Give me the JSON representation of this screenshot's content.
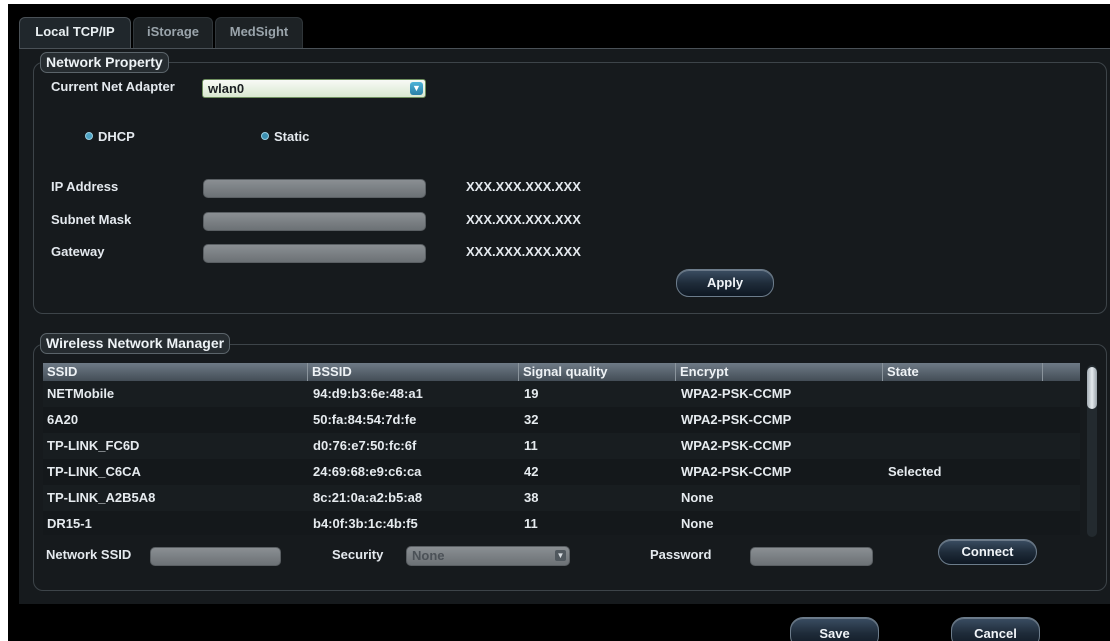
{
  "tabs": [
    {
      "label": "Local TCP/IP",
      "active": true
    },
    {
      "label": "iStorage",
      "active": false
    },
    {
      "label": "MedSight",
      "active": false
    }
  ],
  "network_property": {
    "title": "Network Property",
    "adapter_label": "Current Net Adapter",
    "adapter_value": "wlan0",
    "dhcp_label": "DHCP",
    "static_label": "Static",
    "ip_label": "IP Address",
    "ip_value": "XXX.XXX.XXX.XXX",
    "subnet_label": "Subnet Mask",
    "subnet_value": "XXX.XXX.XXX.XXX",
    "gateway_label": "Gateway",
    "gateway_value": "XXX.XXX.XXX.XXX",
    "apply_label": "Apply"
  },
  "wireless": {
    "title": "Wireless Network Manager",
    "columns": [
      "SSID",
      "BSSID",
      "Signal quality",
      "Encrypt",
      "State"
    ],
    "rows": [
      {
        "ssid": "NETMobile",
        "bssid": "94:d9:b3:6e:48:a1",
        "signal": "19",
        "encrypt": "WPA2-PSK-CCMP",
        "state": ""
      },
      {
        "ssid": "6A20",
        "bssid": "50:fa:84:54:7d:fe",
        "signal": "32",
        "encrypt": "WPA2-PSK-CCMP",
        "state": ""
      },
      {
        "ssid": "TP-LINK_FC6D",
        "bssid": "d0:76:e7:50:fc:6f",
        "signal": "11",
        "encrypt": "WPA2-PSK-CCMP",
        "state": ""
      },
      {
        "ssid": "TP-LINK_C6CA",
        "bssid": "24:69:68:e9:c6:ca",
        "signal": "42",
        "encrypt": "WPA2-PSK-CCMP",
        "state": "Selected"
      },
      {
        "ssid": "TP-LINK_A2B5A8",
        "bssid": "8c:21:0a:a2:b5:a8",
        "signal": "38",
        "encrypt": "None",
        "state": ""
      },
      {
        "ssid": "DR15-1",
        "bssid": "b4:0f:3b:1c:4b:f5",
        "signal": "11",
        "encrypt": "None",
        "state": ""
      }
    ],
    "network_ssid_label": "Network SSID",
    "security_label": "Security",
    "security_value": "None",
    "password_label": "Password",
    "connect_label": "Connect"
  },
  "footer": {
    "save_label": "Save",
    "cancel_label": "Cancel"
  },
  "colors": {
    "background": "#000000",
    "panel": "#161a1d",
    "accent": "#4db3d8"
  }
}
